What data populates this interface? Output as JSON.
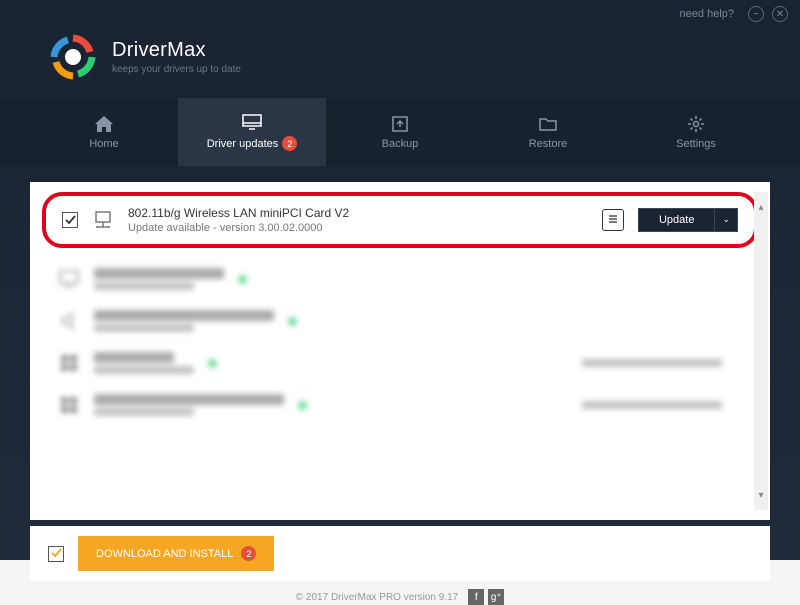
{
  "titlebar": {
    "help": "need help?"
  },
  "brand": {
    "title": "DriverMax",
    "subtitle": "keeps your drivers up to date"
  },
  "nav": {
    "home": "Home",
    "updates": "Driver updates",
    "updates_badge": "2",
    "backup": "Backup",
    "restore": "Restore",
    "settings": "Settings"
  },
  "highlighted": {
    "title": "802.11b/g Wireless LAN miniPCI Card V2",
    "subtitle": "Update available - version 3.00.02.0000",
    "button": "Update"
  },
  "blurred": {
    "r1": "NVIDIA GeForce 210",
    "r2": "High Definition Audio Device",
    "r3": "Intel Device",
    "r4": "Intel(R) 82801 PCI Bridge - 244E"
  },
  "download": {
    "label": "DOWNLOAD AND INSTALL",
    "badge": "2"
  },
  "footer": {
    "copyright": "© 2017 DriverMax PRO version 9.17"
  }
}
